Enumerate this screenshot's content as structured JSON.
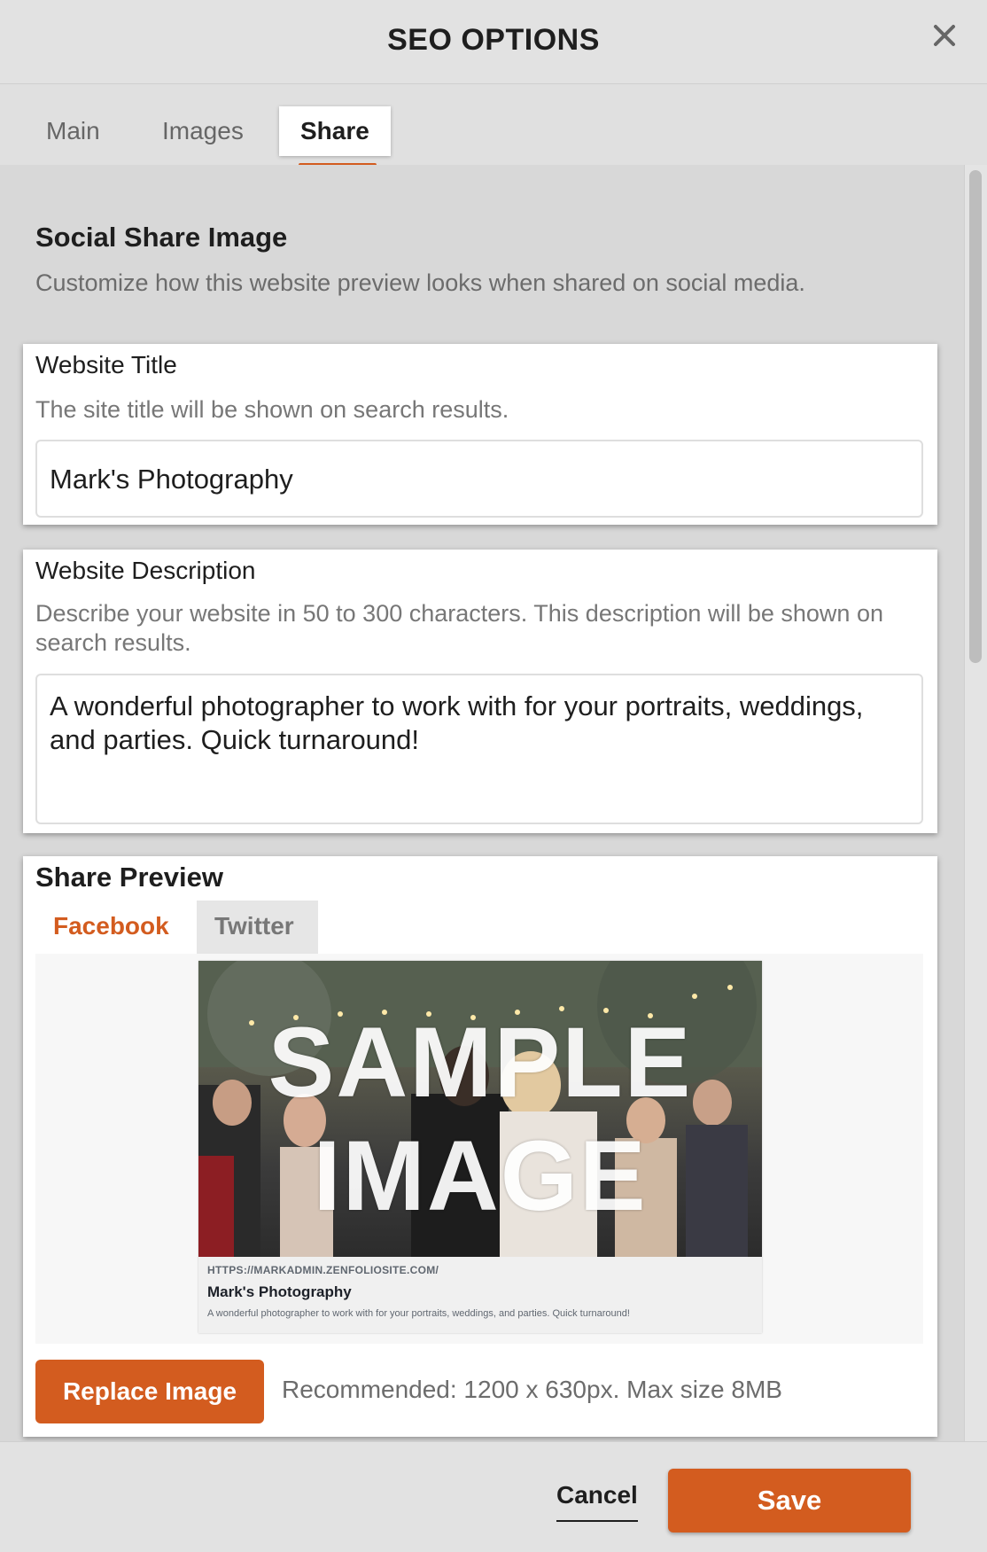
{
  "dialog": {
    "title": "SEO OPTIONS",
    "close_icon": "close-icon"
  },
  "tabs": [
    {
      "label": "Main",
      "active": false
    },
    {
      "label": "Images",
      "active": false
    },
    {
      "label": "Share",
      "active": true
    }
  ],
  "section": {
    "heading": "Social Share Image",
    "subheading": "Customize how this website preview looks when shared on social media."
  },
  "website_title": {
    "label": "Website Title",
    "help": "The site title will be shown on search results.",
    "value": "Mark's Photography"
  },
  "website_description": {
    "label": "Website Description",
    "help": "Describe your website in 50 to 300 characters. This description will be shown on search results.",
    "value": "A wonderful photographer to work with for your portraits, weddings, and parties. Quick turnaround!"
  },
  "share_preview": {
    "label": "Share Preview",
    "tabs": [
      {
        "label": "Facebook",
        "active": true
      },
      {
        "label": "Twitter",
        "active": false
      }
    ],
    "image_watermark": [
      "SAMPLE",
      "IMAGE"
    ],
    "url": "HTTPS://MARKADMIN.ZENFOLIOSITE.COM/",
    "title": "Mark's Photography",
    "description": "A wonderful photographer to work with for your portraits, weddings, and parties. Quick turnaround!"
  },
  "replace": {
    "button_label": "Replace Image",
    "recommendation": "Recommended: 1200 x 630px. Max size 8MB"
  },
  "footer": {
    "cancel_label": "Cancel",
    "save_label": "Save"
  },
  "colors": {
    "accent": "#d35c1f",
    "background": "#e0e0e0"
  }
}
